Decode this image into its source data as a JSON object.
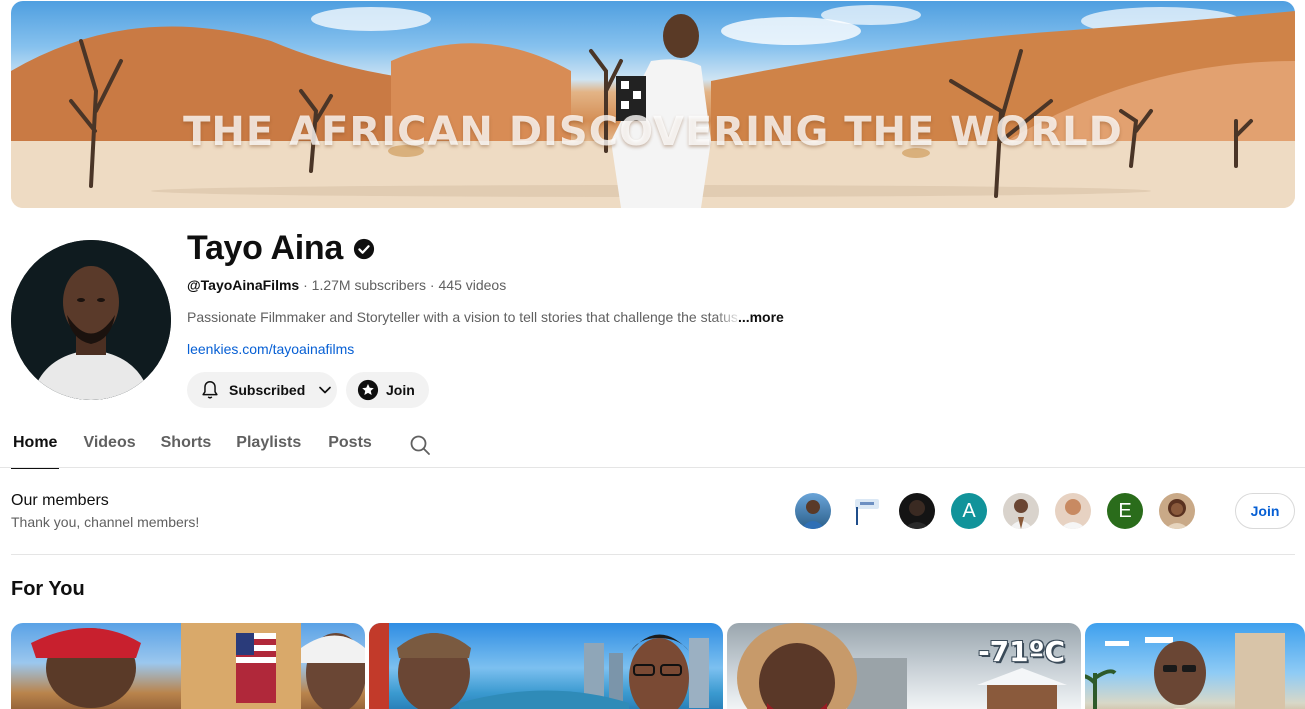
{
  "banner": {
    "text": "THE AFRICAN DISCOVERING THE WORLD"
  },
  "channel": {
    "name": "Tayo Aina",
    "handle": "@TayoAinaFilms",
    "subscribers": "1.27M subscribers",
    "videos": "445 videos",
    "separator": " · ",
    "description": "Passionate Filmmaker and Storyteller with a vision to tell stories that challenge the ",
    "description_fade": "status",
    "more_label": "...more",
    "link": "leenkies.com/tayoainafilms"
  },
  "actions": {
    "subscribed_label": "Subscribed",
    "join_label": "Join"
  },
  "tabs": [
    {
      "label": "Home",
      "active": true
    },
    {
      "label": "Videos"
    },
    {
      "label": "Shorts"
    },
    {
      "label": "Playlists"
    },
    {
      "label": "Posts"
    }
  ],
  "members": {
    "title": "Our members",
    "subtitle": "Thank you, channel members!",
    "avatars": [
      {
        "type": "photo"
      },
      {
        "type": "photo"
      },
      {
        "type": "photo"
      },
      {
        "type": "letter",
        "letter": "A",
        "color": "#11939a"
      },
      {
        "type": "photo"
      },
      {
        "type": "photo"
      },
      {
        "type": "letter",
        "letter": "E",
        "color": "#2a6c1b"
      },
      {
        "type": "photo"
      }
    ],
    "join_label": "Join"
  },
  "section": {
    "title": "For You"
  },
  "thumbnails": [
    {
      "overlay": ""
    },
    {
      "overlay": ""
    },
    {
      "overlay": "-71ºC"
    },
    {
      "overlay": ""
    }
  ],
  "colors": {
    "link": "#065fd4",
    "muted": "#606060",
    "pill": "#f2f2f2"
  }
}
